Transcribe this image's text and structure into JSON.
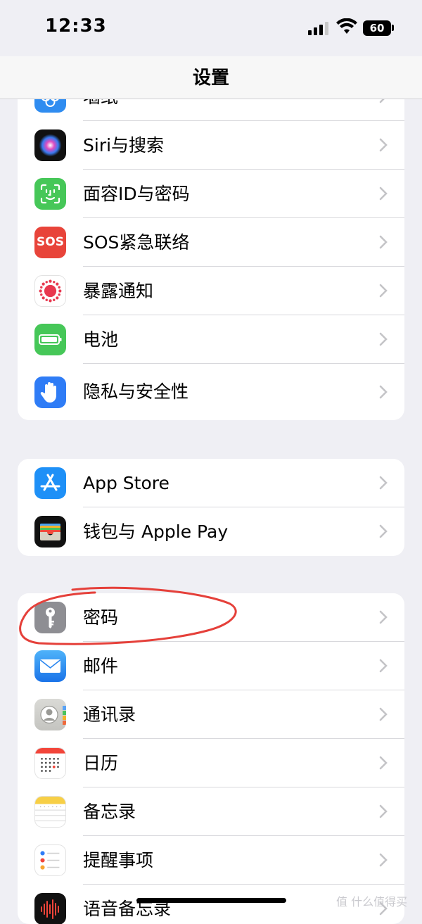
{
  "status_bar": {
    "time": "12:33",
    "battery": "60"
  },
  "nav": {
    "title": "设置"
  },
  "group1": [
    {
      "label": "墙纸",
      "icon": "wallpaper-icon"
    },
    {
      "label": "Siri与搜索",
      "icon": "siri-icon"
    },
    {
      "label": "面容ID与密码",
      "icon": "face-id-icon"
    },
    {
      "label": "SOS紧急联络",
      "icon": "sos-icon",
      "icon_text": "SOS"
    },
    {
      "label": "暴露通知",
      "icon": "exposure-notification-icon"
    },
    {
      "label": "电池",
      "icon": "battery-icon"
    },
    {
      "label": "隐私与安全性",
      "icon": "privacy-hand-icon"
    }
  ],
  "group2": [
    {
      "label": "App Store",
      "icon": "app-store-icon"
    },
    {
      "label": "钱包与 Apple Pay",
      "icon": "wallet-icon"
    }
  ],
  "group3": [
    {
      "label": "密码",
      "icon": "key-icon"
    },
    {
      "label": "邮件",
      "icon": "mail-icon"
    },
    {
      "label": "通讯录",
      "icon": "contacts-icon"
    },
    {
      "label": "日历",
      "icon": "calendar-icon"
    },
    {
      "label": "备忘录",
      "icon": "notes-icon"
    },
    {
      "label": "提醒事项",
      "icon": "reminders-icon"
    },
    {
      "label": "语音备忘录",
      "icon": "voice-memos-icon"
    }
  ],
  "watermark": "值 什么值得买",
  "colors": {
    "annotation": "#e5403a",
    "chevron": "#c4c4c7",
    "background": "#efeff4"
  }
}
